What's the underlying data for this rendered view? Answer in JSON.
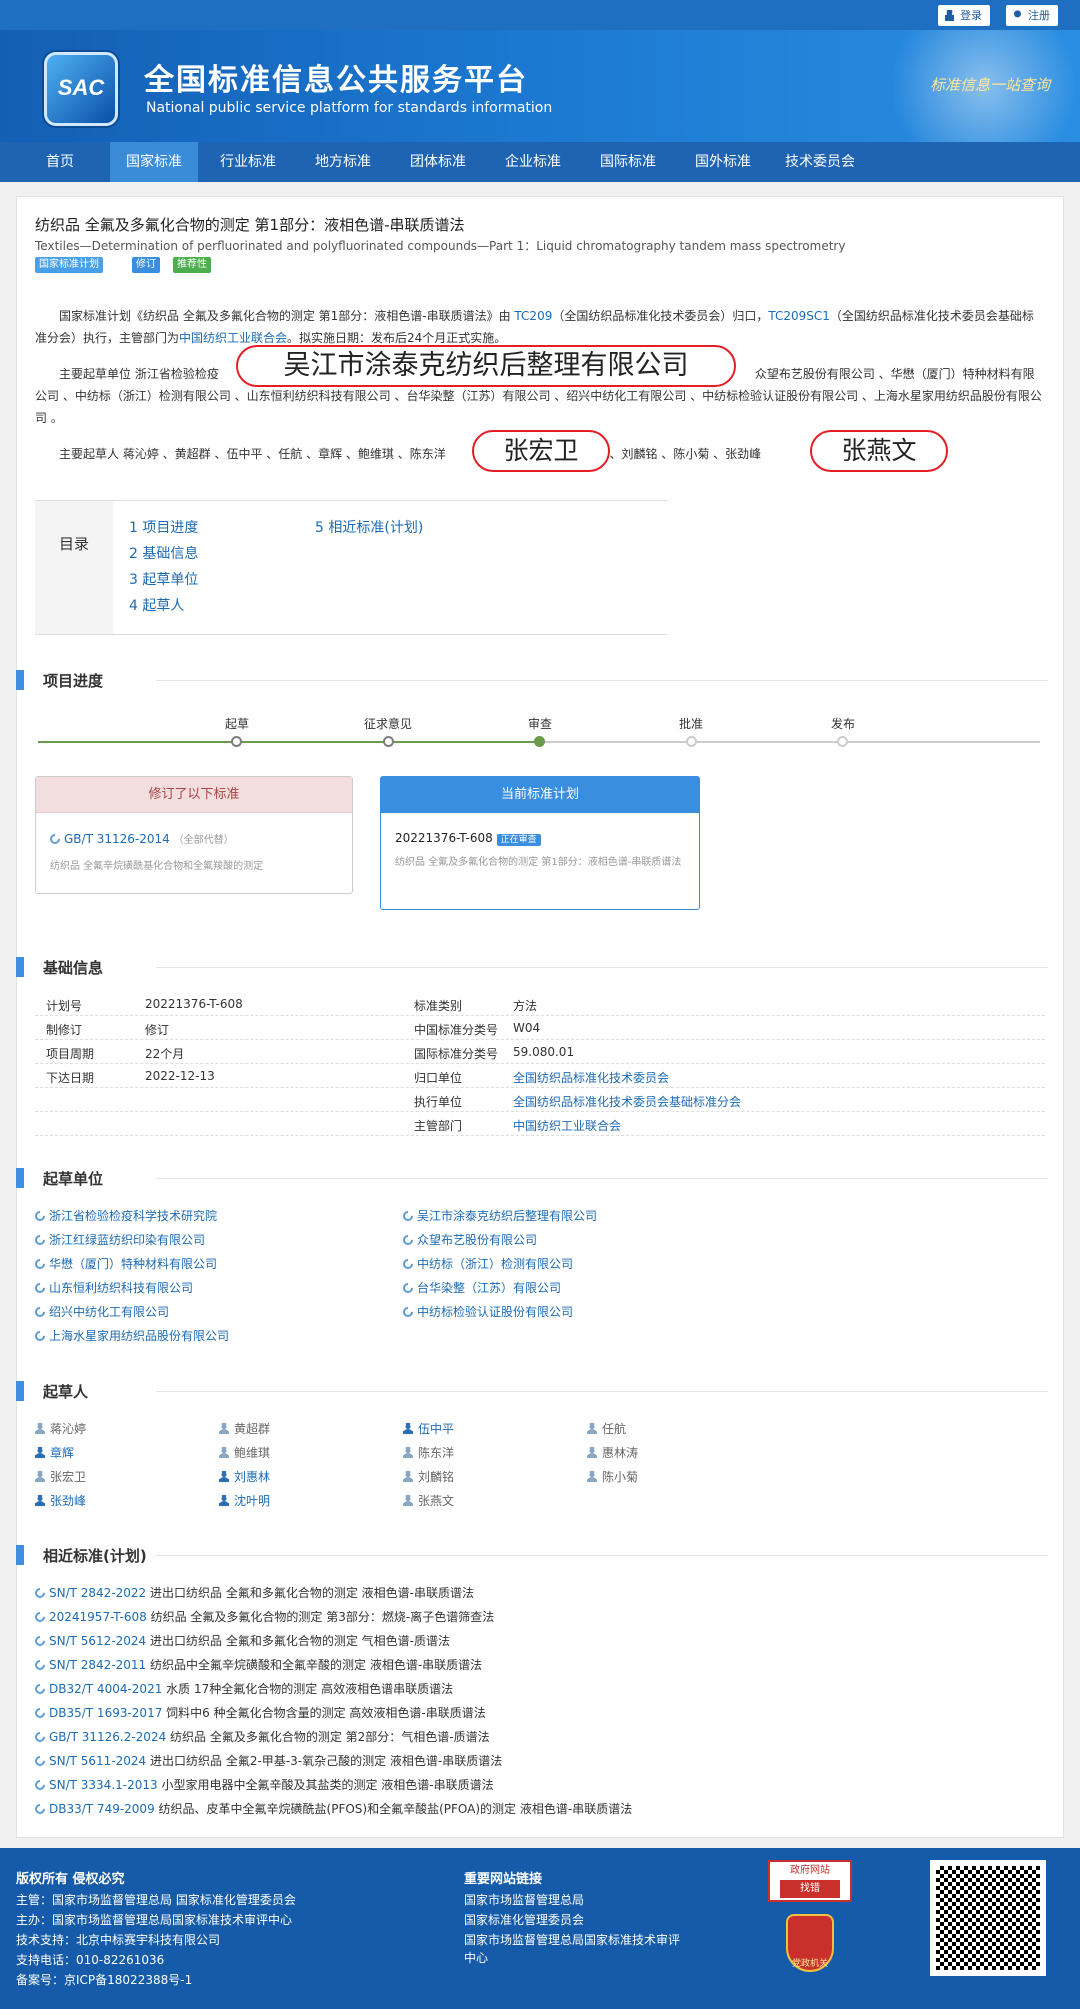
{
  "header": {
    "login": "登录",
    "register": "注册",
    "logo_text": "SAC",
    "site_title": "全国标准信息公共服务平台",
    "site_subtitle": "National public service platform  for standards information",
    "slogan": "标准信息一站查询"
  },
  "nav": [
    "首页",
    "国家标准",
    "行业标准",
    "地方标准",
    "团体标准",
    "企业标准",
    "国际标准",
    "国外标准",
    "技术委员会"
  ],
  "standard": {
    "title_cn": "纺织品 全氟及多氟化合物的测定 第1部分：液相色谱-串联质谱法",
    "title_en": "Textiles—Determination of perfluorinated and polyfluorinated compounds—Part 1：Liquid chromatography tandem mass spectrometry",
    "tags": [
      "国家标准计划",
      "修订",
      "推荐性"
    ],
    "intro_a": "国家标准计划《纺织品 全氟及多氟化合物的测定 第1部分：液相色谱-串联质谱法》由 ",
    "intro_tc": "TC209",
    "intro_b": "（全国纺织品标准化技术委员会）归口，",
    "intro_sc": "TC209SC1",
    "intro_c": "（全国纺织品标准化技术委员会基础标准分会）执行，主管部门为",
    "intro_dept": "中国纺织工业联合会",
    "intro_d": "。拟实施日期：发布后24个月正式实施。",
    "orgs_para_a": "主要起草单位 浙江省检验检疫",
    "orgs_para_b": "众望布艺股份有限公司 、华懋（厦门）特种材料有限公司 、中纺标（浙江）检测有限公司 、山东恒利纺织科技有限公司 、台华染整（江苏）有限公司 、绍兴中纺化工有限公司 、中纺标检验认证股份有限公司 、上海水星家用纺织品股份有限公司 。",
    "people_para_a": "主要起草人 蒋沁婷 、黄超群 、伍中平 、任航 、章辉 、鲍维琪 、陈东洋",
    "people_para_b": "刘惠林 、刘麟铭 、陈小菊 、张劲峰",
    "stamp_org": "吴江市涂泰克纺织后整理有限公司",
    "stamp_person1": "张宏卫",
    "stamp_person2": "张燕文"
  },
  "toc": {
    "label": "目录",
    "items": [
      "1  项目进度",
      "2  基础信息",
      "3  起草单位",
      "4  起草人",
      "5  相近标准(计划)"
    ]
  },
  "progress": {
    "section": "项目进度",
    "stages": [
      "起草",
      "征求意见",
      "审查",
      "批准",
      "发布"
    ],
    "current_stage": "审查",
    "left_box_title": "修订了以下标准",
    "left_code": "GB/T 31126-2014",
    "left_note": "（全部代替）",
    "left_name": "纺织品 全氟辛烷磺酰基化合物和全氟羧酸的测定",
    "right_box_title": "当前标准计划",
    "right_code": "20221376-T-608",
    "right_badge": "正在审查",
    "right_name": "纺织品 全氟及多氟化合物的测定 第1部分：液相色谱-串联质谱法"
  },
  "basic": {
    "section": "基础信息",
    "left": [
      {
        "k": "计划号",
        "v": "20221376-T-608"
      },
      {
        "k": "制修订",
        "v": "修订"
      },
      {
        "k": "项目周期",
        "v": "22个月"
      },
      {
        "k": "下达日期",
        "v": "2022-12-13"
      }
    ],
    "right": [
      {
        "k": "标准类别",
        "v": "方法"
      },
      {
        "k": "中国标准分类号",
        "v": "W04"
      },
      {
        "k": "国际标准分类号",
        "v": "59.080.01"
      },
      {
        "k": "归口单位",
        "v": "全国纺织品标准化技术委员会"
      },
      {
        "k": "执行单位",
        "v": "全国纺织品标准化技术委员会基础标准分会"
      },
      {
        "k": "主管部门",
        "v": "中国纺织工业联合会"
      }
    ]
  },
  "drafting_units": {
    "section": "起草单位",
    "items": [
      "浙江省检验检疫科学技术研究院",
      "吴江市涂泰克纺织后整理有限公司",
      "浙江红绿蓝纺织印染有限公司",
      "众望布艺股份有限公司",
      "华懋（厦门）特种材料有限公司",
      "中纺标（浙江）检测有限公司",
      "山东恒利纺织科技有限公司",
      "台华染整（江苏）有限公司",
      "绍兴中纺化工有限公司",
      "中纺标检验认证股份有限公司",
      "上海水星家用纺织品股份有限公司"
    ]
  },
  "drafters": {
    "section": "起草人",
    "items": [
      "蒋沁婷",
      "黄超群",
      "伍中平",
      "任航",
      "章辉",
      "鲍维琪",
      "陈东洋",
      "惠林涛",
      "张宏卫",
      "刘惠林",
      "刘麟铭",
      "陈小菊",
      "张劲峰",
      "沈叶明",
      "张燕文"
    ]
  },
  "similar": {
    "section": "相近标准(计划)",
    "items": [
      {
        "code": "SN/T 2842-2022",
        "name": "进出口纺织品 全氟和多氟化合物的测定 液相色谱-串联质谱法"
      },
      {
        "code": "20241957-T-608",
        "name": "纺织品 全氟及多氟化合物的测定 第3部分：燃烧-离子色谱筛查法"
      },
      {
        "code": "SN/T 5612-2024",
        "name": "进出口纺织品 全氟和多氟化合物的测定 气相色谱-质谱法"
      },
      {
        "code": "SN/T 2842-2011",
        "name": "纺织品中全氟辛烷磺酸和全氟辛酸的测定 液相色谱-串联质谱法"
      },
      {
        "code": "DB32/T 4004-2021",
        "name": "水质 17种全氟化合物的测定 高效液相色谱串联质谱法"
      },
      {
        "code": "DB35/T 1693-2017",
        "name": "饲料中6 种全氟化合物含量的测定 高效液相色谱-串联质谱法"
      },
      {
        "code": "GB/T 31126.2-2024",
        "name": "纺织品 全氟及多氟化合物的测定 第2部分：气相色谱-质谱法"
      },
      {
        "code": "SN/T 5611-2024",
        "name": "进出口纺织品 全氟2-甲基-3-氧杂己酸的测定 液相色谱-串联质谱法"
      },
      {
        "code": "SN/T 3334.1-2013",
        "name": "小型家用电器中全氟辛酸及其盐类的测定 液相色谱-串联质谱法"
      },
      {
        "code": "DB33/T 749-2009",
        "name": "纺织品、皮革中全氟辛烷磺酰盐(PFOS)和全氟辛酸盐(PFOA)的测定 液相色谱-串联质谱法"
      }
    ]
  },
  "footer": {
    "copyright_title": "版权所有 侵权必究",
    "lines": [
      "主管：国家市场监督管理总局 国家标准化管理委员会",
      "主办：国家市场监督管理总局国家标准技术审评中心",
      "技术支持：北京中标赛宇科技有限公司",
      "支持电话：010-82261036",
      "备案号：京ICP备18022388号-1"
    ],
    "links_title": "重要网站链接",
    "links": [
      "国家市场监督管理总局",
      "国家标准化管理委员会",
      "国家市场监督管理总局国家标准技术审评",
      "中心"
    ],
    "badge1_top": "政府网站",
    "badge1_bottom": "找错",
    "badge2": "党政机关"
  }
}
